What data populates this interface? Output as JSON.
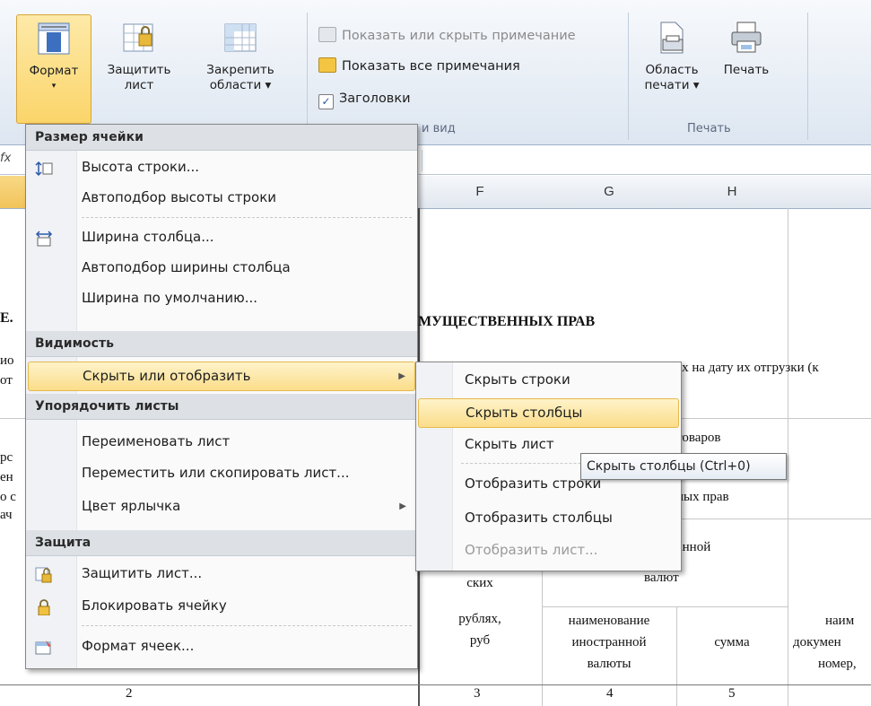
{
  "ribbon": {
    "format": {
      "label1": "Формат",
      "arrow": "▾"
    },
    "protect_sheet": {
      "label1": "Защитить",
      "label2": "лист"
    },
    "freeze": {
      "label1": "Закрепить",
      "label2": "области ▾"
    },
    "show_hide_note": "Показать или скрыть примечание",
    "show_all_notes": "Показать все примечания",
    "headings": "Заголовки",
    "headings_check": "✓",
    "group_view": "и вид",
    "print_area": {
      "label1": "Область",
      "label2": "печати ▾"
    },
    "print": {
      "label1": "Печать"
    },
    "group_print": "Печать"
  },
  "formula_bar": {
    "fx": "fx"
  },
  "columns": [
    "F",
    "G",
    "H"
  ],
  "sheet": {
    "row_left1": "Е.",
    "row_left2": "ио",
    "row_left3": "от",
    "row_left4": "рс",
    "row_left5": "ен",
    "row_left6": "о с",
    "row_left7": "ач",
    "title_fragment": "МУЩЕСТВЕННЫХ ПРАВ",
    "subtitle_fragment": "ых на дату их отгрузки (к",
    "goods_fragment": "товаров",
    "rights_fragment": "ных прав",
    "currency_fragment1": "анной",
    "currency_fragment2": "валют",
    "f_col_text1": "ских",
    "f_col_text2": "рублях,",
    "f_col_text3": "руб",
    "g_col_text1": "наименование",
    "g_col_text2": "иностранной",
    "g_col_text3": "валюты",
    "h_col_text": "сумма",
    "i_col_text1": "наим",
    "i_col_text2": "докумен",
    "i_col_text3": "номер,",
    "num_2": "2",
    "num_3": "3",
    "num_4": "4",
    "num_5": "5"
  },
  "format_menu": {
    "h_cell_size": "Размер ячейки",
    "row_height": "Высота строки...",
    "autofit_row": "Автоподбор высоты строки",
    "col_width": "Ширина столбца...",
    "autofit_col": "Автоподбор ширины столбца",
    "default_width": "Ширина по умолчанию...",
    "h_visibility": "Видимость",
    "hide_show": "Скрыть или отобразить",
    "h_organize": "Упорядочить листы",
    "rename": "Переименовать лист",
    "move_copy": "Переместить или скопировать лист...",
    "tab_color": "Цвет ярлычка",
    "h_protection": "Защита",
    "protect_sheet": "Защитить лист...",
    "lock_cell": "Блокировать ячейку",
    "format_cells": "Формат ячеек...",
    "submenu_arrow": "▶"
  },
  "hide_submenu": {
    "hide_rows": "Скрыть строки",
    "hide_cols": "Скрыть столбцы",
    "hide_sheet": "Скрыть лист",
    "show_rows": "Отобразить строки",
    "show_cols": "Отобразить столбцы",
    "show_sheet": "Отобразить лист..."
  },
  "tooltip": "Скрыть столбцы (Ctrl+0)",
  "colors": {
    "highlight": "#fbdd8a",
    "accent_border": "#e5b94e",
    "ribbon_bg": "#dde6f1"
  }
}
